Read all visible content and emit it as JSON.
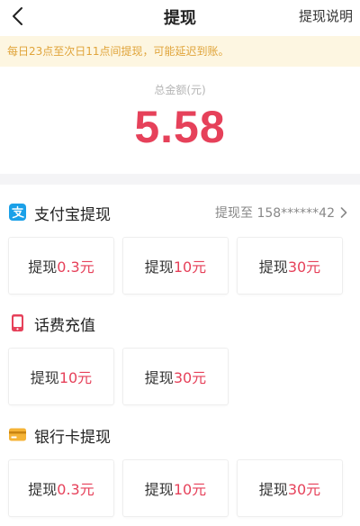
{
  "navbar": {
    "title": "提现",
    "right_link": "提现说明"
  },
  "notice": "每日23点至次日11点间提现，可能延迟到账。",
  "total": {
    "label": "总金额(元)",
    "amount": "5.58"
  },
  "sections": {
    "alipay": {
      "title": "支付宝提现",
      "account": "提现至 158******42",
      "options": [
        {
          "prefix": "提现",
          "amount": "0.3元"
        },
        {
          "prefix": "提现",
          "amount": "10元"
        },
        {
          "prefix": "提现",
          "amount": "30元"
        }
      ]
    },
    "phone": {
      "title": "话费充值",
      "options": [
        {
          "prefix": "提现",
          "amount": "10元"
        },
        {
          "prefix": "提现",
          "amount": "30元"
        }
      ]
    },
    "bank": {
      "title": "银行卡提现",
      "options": [
        {
          "prefix": "提现",
          "amount": "0.3元"
        },
        {
          "prefix": "提现",
          "amount": "10元"
        },
        {
          "prefix": "提现",
          "amount": "30元"
        }
      ]
    }
  },
  "icons": {
    "back": "chevron-left-icon",
    "alipay": "alipay-icon",
    "phone": "phone-icon",
    "bank": "bank-card-icon",
    "chevron": "chevron-right-icon"
  },
  "colors": {
    "accent": "#e6415a",
    "notice_text": "#e0a43a",
    "notice_bg": "#fdf6e1",
    "alipay_blue": "#1aa0e8",
    "phone_red": "#e6415a",
    "bank_yellow": "#f5b335"
  }
}
